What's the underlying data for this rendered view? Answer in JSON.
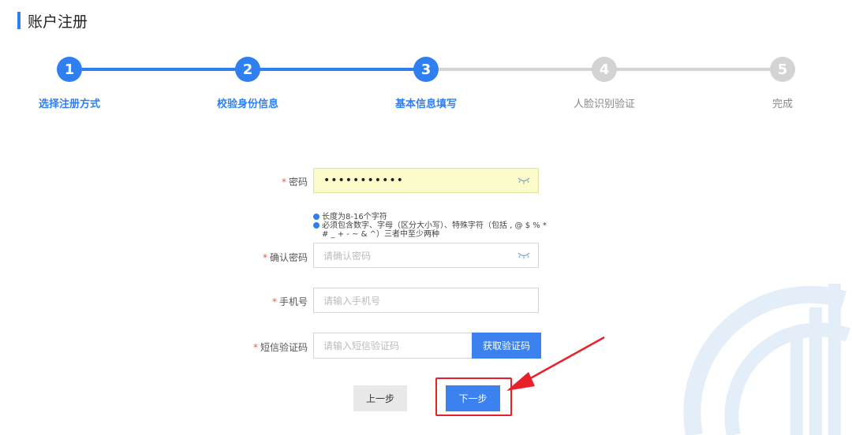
{
  "header": {
    "title": "账户注册",
    "accent_color": "#2f7ff0"
  },
  "steps": [
    {
      "num": "1",
      "label": "选择注册方式",
      "state": "done"
    },
    {
      "num": "2",
      "label": "校验身份信息",
      "state": "done"
    },
    {
      "num": "3",
      "label": "基本信息填写",
      "state": "current"
    },
    {
      "num": "4",
      "label": "人脸识别验证",
      "state": "todo"
    },
    {
      "num": "5",
      "label": "完成",
      "state": "todo"
    }
  ],
  "form": {
    "required_mark": "*",
    "password": {
      "label": "密码",
      "value": "•••••••••••"
    },
    "hints": [
      "长度为8-16个字符",
      "必须包含数字、字母（区分大小写）、特殊字符（包括 , @ $ % * # _ + - ~ & ^）三者中至少两种"
    ],
    "confirm_password": {
      "label": "确认密码",
      "placeholder": "请确认密码"
    },
    "phone": {
      "label": "手机号",
      "placeholder": "请输入手机号"
    },
    "sms_code": {
      "label": "短信验证码",
      "placeholder": "请输入短信验证码",
      "button": "获取验证码"
    }
  },
  "buttons": {
    "prev": "上一步",
    "next": "下一步"
  },
  "colors": {
    "primary": "#3b82f0",
    "inactive": "#d3d3d3",
    "annotation": "#e8202a"
  },
  "icons": {
    "password_toggle": "eye-closed-icon"
  }
}
